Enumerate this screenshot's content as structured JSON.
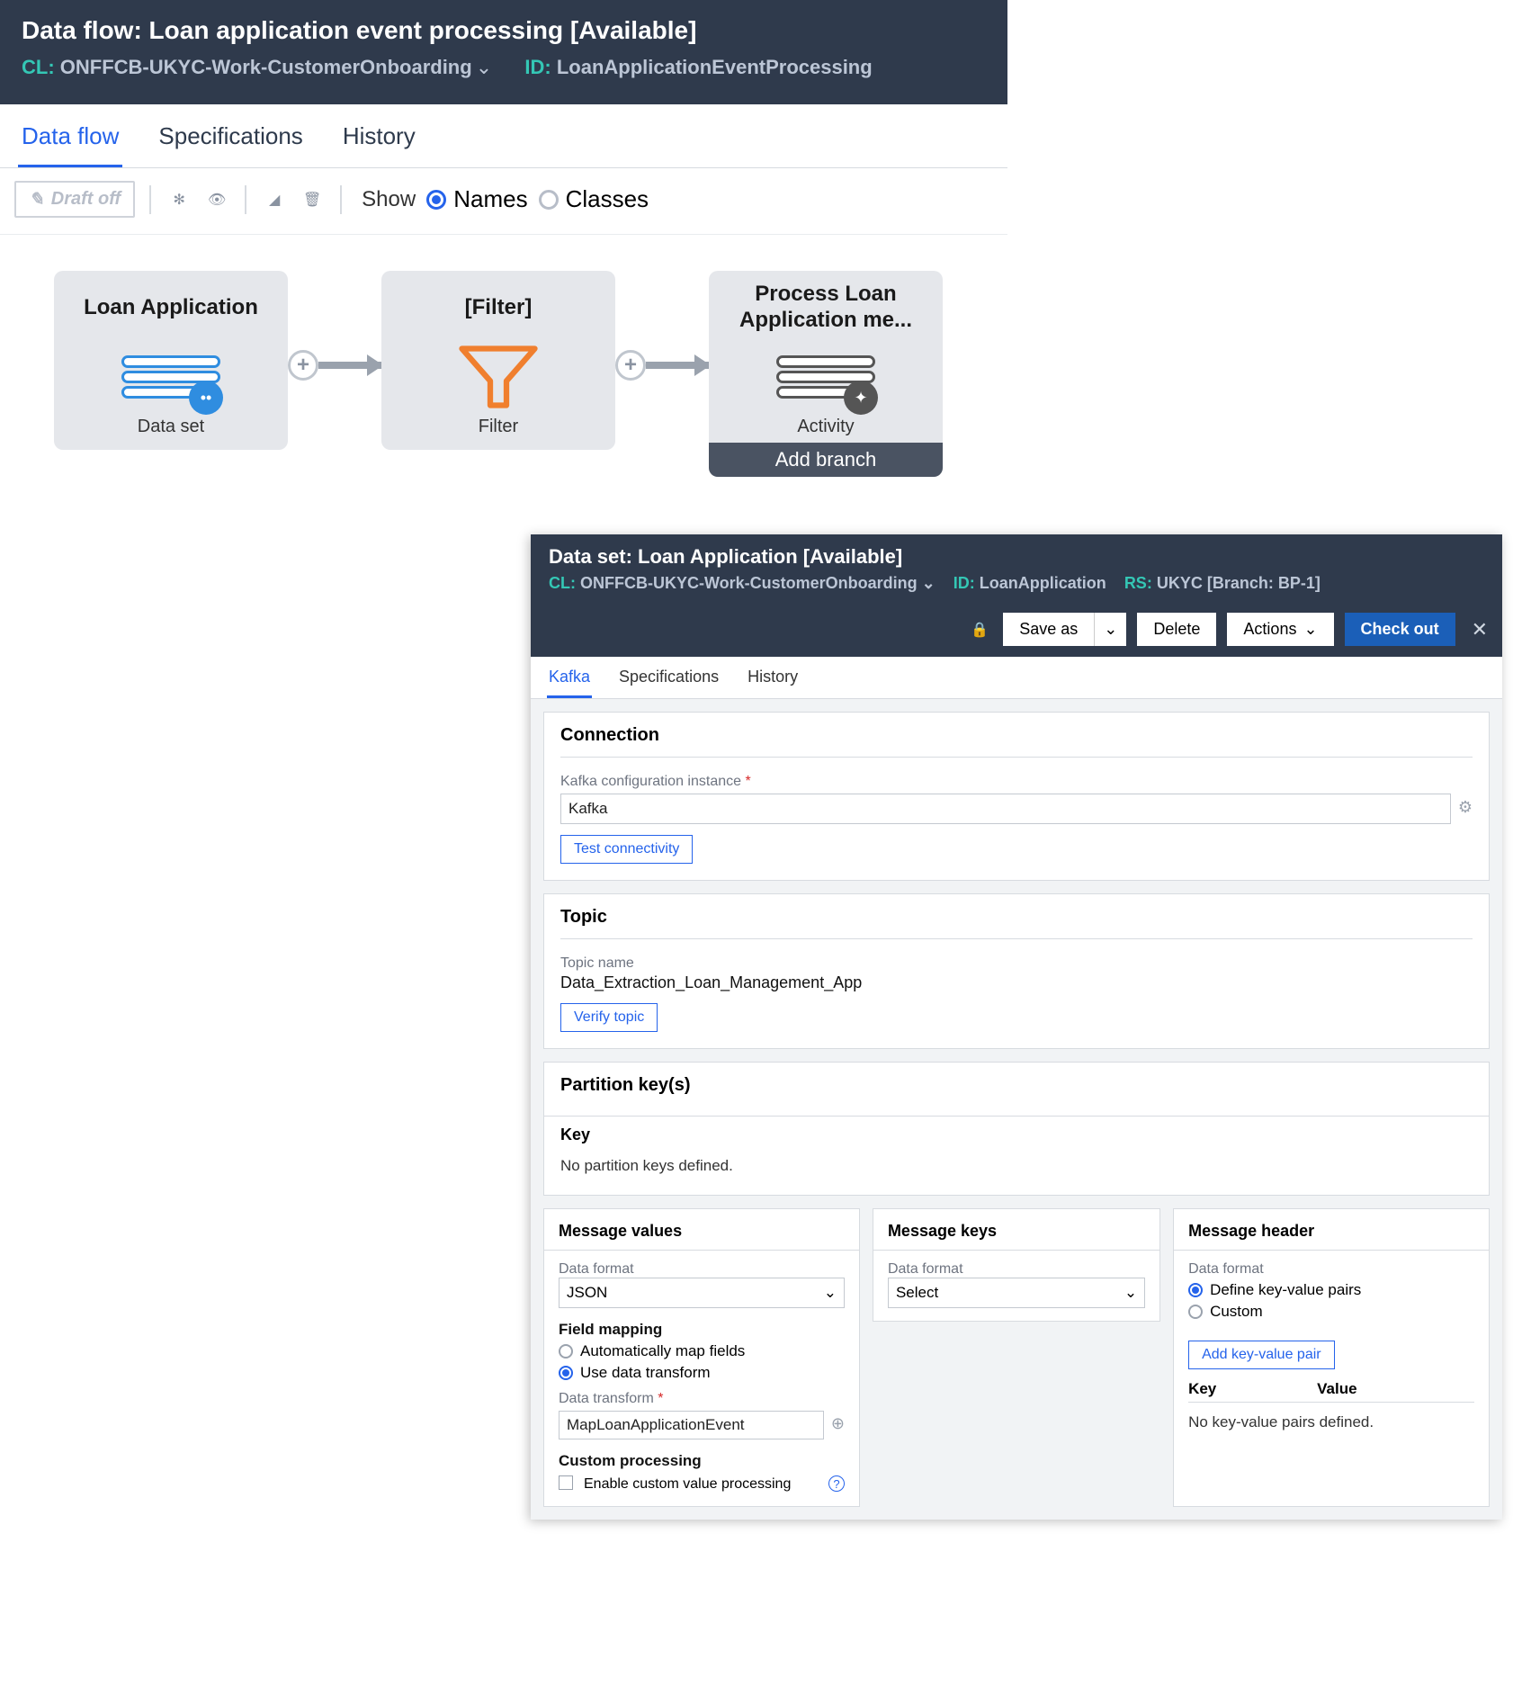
{
  "panel1": {
    "title": "Data flow: Loan application event processing [Available]",
    "cl_label": "CL:",
    "cl_value": "ONFFCB-UKYC-Work-CustomerOnboarding",
    "id_label": "ID:",
    "id_value": "LoanApplicationEventProcessing",
    "tabs": {
      "dataflow": "Data flow",
      "specs": "Specifications",
      "history": "History"
    },
    "toolbar": {
      "draft_off": "Draft off",
      "show_label": "Show",
      "names": "Names",
      "classes": "Classes"
    },
    "nodes": {
      "n1": {
        "title": "Loan Application",
        "caption": "Data set"
      },
      "n2": {
        "title": "[Filter]",
        "caption": "Filter"
      },
      "n3": {
        "title": "Process Loan Application me...",
        "caption": "Activity",
        "add_branch": "Add branch"
      }
    }
  },
  "panel2": {
    "title": "Data set: Loan Application [Available]",
    "cl_label": "CL:",
    "cl_value": "ONFFCB-UKYC-Work-CustomerOnboarding",
    "id_label": "ID:",
    "id_value": "LoanApplication",
    "rs_label": "RS:",
    "rs_value": "UKYC [Branch: BP-1]",
    "actions": {
      "save_as": "Save as",
      "delete": "Delete",
      "actions": "Actions",
      "check_out": "Check out"
    },
    "tabs": {
      "kafka": "Kafka",
      "specs": "Specifications",
      "history": "History"
    },
    "connection": {
      "section": "Connection",
      "label": "Kafka configuration instance",
      "value": "Kafka",
      "test": "Test connectivity"
    },
    "topic": {
      "section": "Topic",
      "label": "Topic name",
      "value": "Data_Extraction_Loan_Management_App",
      "verify": "Verify topic"
    },
    "partition": {
      "section": "Partition key(s)",
      "key_label": "Key",
      "empty": "No partition keys defined."
    },
    "msgvalues": {
      "title": "Message values",
      "format_label": "Data format",
      "format_value": "JSON",
      "mapping_title": "Field mapping",
      "auto": "Automatically map fields",
      "use_dt": "Use data transform",
      "dt_label": "Data transform",
      "dt_value": "MapLoanApplicationEvent",
      "custom_title": "Custom processing",
      "custom_opt": "Enable custom value processing"
    },
    "msgkeys": {
      "title": "Message keys",
      "format_label": "Data format",
      "select": "Select"
    },
    "msgheader": {
      "title": "Message header",
      "format_label": "Data format",
      "define": "Define key-value pairs",
      "custom": "Custom",
      "add": "Add key-value pair",
      "key": "Key",
      "value": "Value",
      "empty": "No key-value pairs defined."
    }
  }
}
